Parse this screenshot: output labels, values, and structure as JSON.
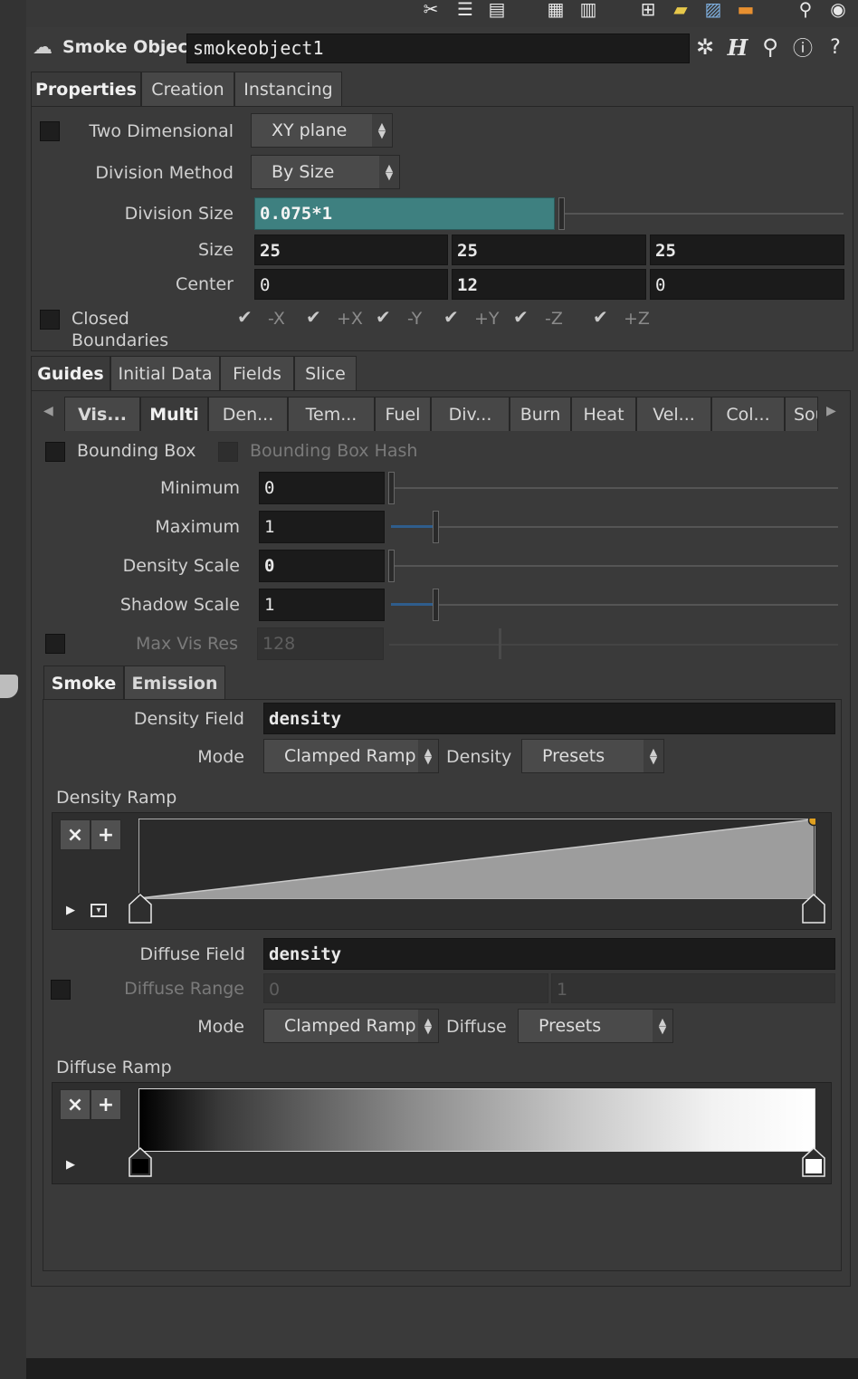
{
  "header": {
    "node_type": "Smoke Object",
    "node_name": "smokeobject1"
  },
  "top_tabs": [
    {
      "label": "Properties"
    },
    {
      "label": "Creation"
    },
    {
      "label": "Instancing"
    }
  ],
  "properties": {
    "two_dimensional": {
      "label": "Two Dimensional",
      "value": "XY plane"
    },
    "division_method": {
      "label": "Division Method",
      "value": "By Size"
    },
    "division_size": {
      "label": "Division Size",
      "value": "0.075*1"
    },
    "size": {
      "label": "Size",
      "values": [
        "25",
        "25",
        "25"
      ]
    },
    "center": {
      "label": "Center",
      "values": [
        "0",
        "12",
        "0"
      ]
    },
    "closed_boundaries": {
      "label": "Closed Boundaries",
      "axes": [
        "-X",
        "+X",
        "-Y",
        "+Y",
        "-Z",
        "+Z"
      ]
    }
  },
  "mid_tabs": [
    {
      "label": "Guides"
    },
    {
      "label": "Initial Data"
    },
    {
      "label": "Fields"
    },
    {
      "label": "Slice"
    }
  ],
  "guide_tabs": [
    {
      "label": "Vis..."
    },
    {
      "label": "Multi"
    },
    {
      "label": "Den..."
    },
    {
      "label": "Tem..."
    },
    {
      "label": "Fuel"
    },
    {
      "label": "Div..."
    },
    {
      "label": "Burn"
    },
    {
      "label": "Heat"
    },
    {
      "label": "Vel..."
    },
    {
      "label": "Col..."
    },
    {
      "label": "Sou"
    }
  ],
  "guides": {
    "bounding_box": "Bounding Box",
    "bounding_box_hash": "Bounding Box Hash",
    "minimum": {
      "label": "Minimum",
      "value": "0"
    },
    "maximum": {
      "label": "Maximum",
      "value": "1"
    },
    "density_scale": {
      "label": "Density Scale",
      "value": "0"
    },
    "shadow_scale": {
      "label": "Shadow Scale",
      "value": "1"
    },
    "max_vis_res": {
      "label": "Max Vis Res",
      "value": "128"
    }
  },
  "smoke_tabs": [
    {
      "label": "Smoke"
    },
    {
      "label": "Emission"
    }
  ],
  "smoke": {
    "density_field": {
      "label": "Density Field",
      "value": "density"
    },
    "mode1": {
      "label": "Mode",
      "value": "Clamped Ramp",
      "preset_label": "Density",
      "preset": "Presets"
    },
    "density_ramp": {
      "label": "Density Ramp"
    },
    "diffuse_field": {
      "label": "Diffuse Field",
      "value": "density"
    },
    "diffuse_range": {
      "label": "Diffuse Range",
      "values": [
        "0",
        "1"
      ]
    },
    "mode2": {
      "label": "Mode",
      "value": "Clamped Ramp",
      "preset_label": "Diffuse",
      "preset": "Presets"
    },
    "diffuse_ramp": {
      "label": "Diffuse Ramp"
    }
  },
  "ramp_buttons": {
    "remove": "×",
    "add": "+"
  },
  "colors": {
    "accent_field": "#3e8080",
    "panel": "#3a3a3a",
    "field": "#1b1b1b",
    "ramp_key": "#e0a020"
  }
}
